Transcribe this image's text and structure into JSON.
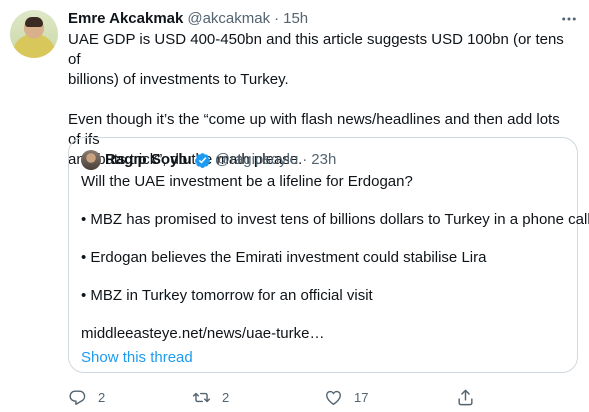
{
  "author": {
    "name": "Emre Akcakmak",
    "handle": "@akcakmak",
    "separator": "·",
    "time": "15h"
  },
  "tweet_text": {
    "line1": "UAE GDP is USD 400-450bn and this article suggests USD 100bn (or tens of",
    "line2": "billions) of investments to Turkey.",
    "line3": "Even though it’s the “come up with flash news/headlines and then add lots of ifs",
    "line4": "and buts trick”, do the math please."
  },
  "more_icon": "more-horizontal-icon",
  "quoted": {
    "name": "Ragıp Soylu",
    "verified_icon": "verified-badge-icon",
    "handle": "@ragipsoylu",
    "separator": "·",
    "time": "23h",
    "line1": "Will the UAE investment be a lifeline for Erdogan?",
    "bullet1": "• MBZ has promised to invest tens of billions dollars to Turkey in a phone call",
    "bullet2": "• Erdogan believes the Emirati investment could stabilise Lira",
    "bullet3": "• MBZ in Turkey tomorrow for an official visit",
    "link": "middleeasteye.net/news/uae-turke…",
    "show_thread": "Show this thread"
  },
  "actions": {
    "reply_count": "2",
    "retweet_count": "2",
    "like_count": "17"
  },
  "colors": {
    "text": "#0f1419",
    "secondary": "#536471",
    "link": "#1d9bf0",
    "verified": "#1d9bf0",
    "border": "#cfd9de"
  }
}
